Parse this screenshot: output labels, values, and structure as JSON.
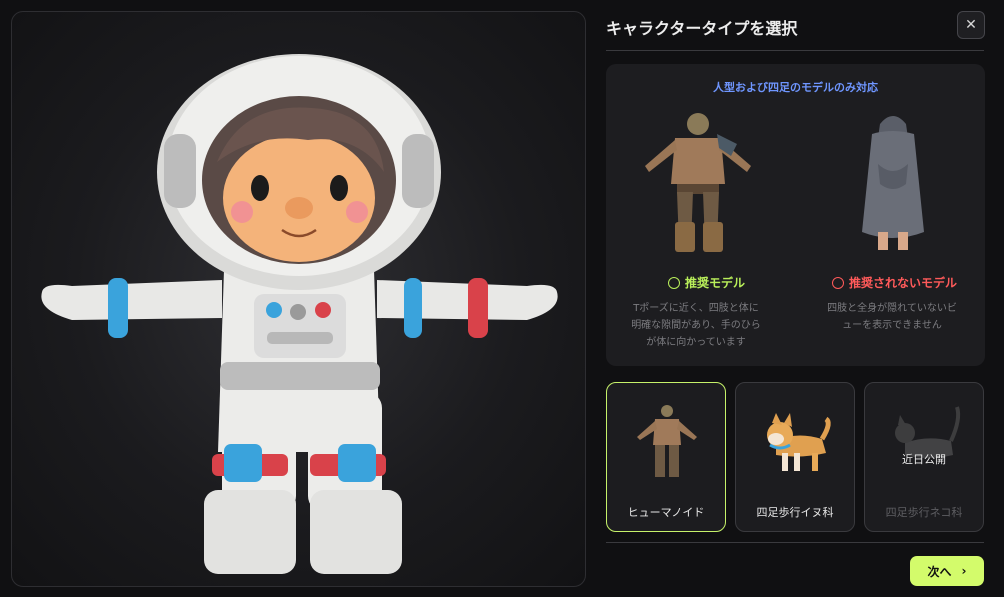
{
  "panel": {
    "title": "キャラクタータイプを選択",
    "close_icon": "close-icon"
  },
  "info": {
    "heading": "人型および四足のモデルのみ対応",
    "heading_color": "#6f96ff",
    "recommended": {
      "label": "推奨モデル",
      "color": "#b9ef5a",
      "description": "Tポーズに近く、四肢と体に明確な隙間があり、手のひらが体に向かっています"
    },
    "not_recommended": {
      "label": "推奨されないモデル",
      "color": "#ff5a5a",
      "description": "四肢と全身が隠れていないビューを表示できません"
    }
  },
  "types": [
    {
      "label": "ヒューマノイド",
      "selected": true
    },
    {
      "label": "四足歩行イヌ科",
      "selected": false
    },
    {
      "label": "四足歩行ネコ科",
      "selected": false,
      "disabled": true,
      "badge": "近日公開"
    }
  ],
  "footer": {
    "next_label": "次へ",
    "accent": "#d3fb6b"
  }
}
